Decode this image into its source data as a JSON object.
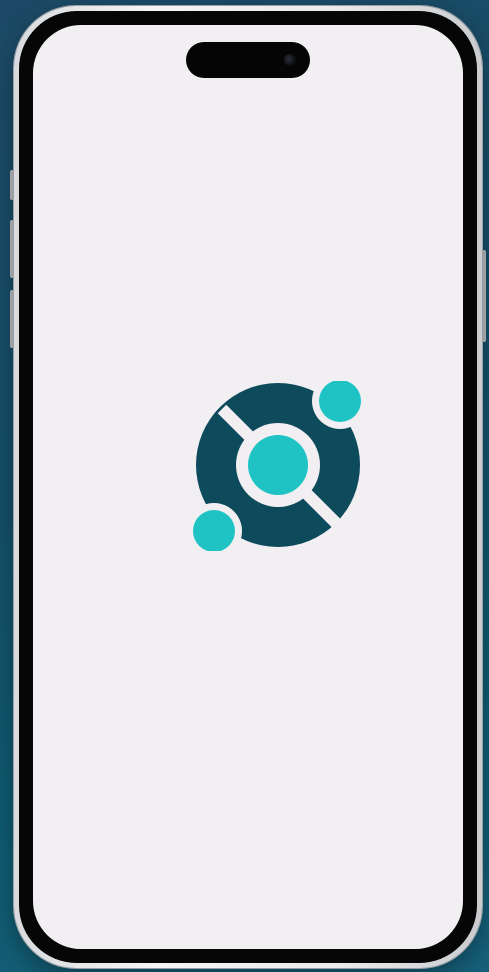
{
  "device": {
    "type": "smartphone",
    "screen_background": "#f1eff2"
  },
  "screen": {
    "state": "splash-screen",
    "logo": {
      "icon_name": "orbit-logo-icon",
      "colors": {
        "dark_ring": "#0d4a5c",
        "accent": "#1fc3c4",
        "gap": "#f1eff2"
      }
    }
  }
}
